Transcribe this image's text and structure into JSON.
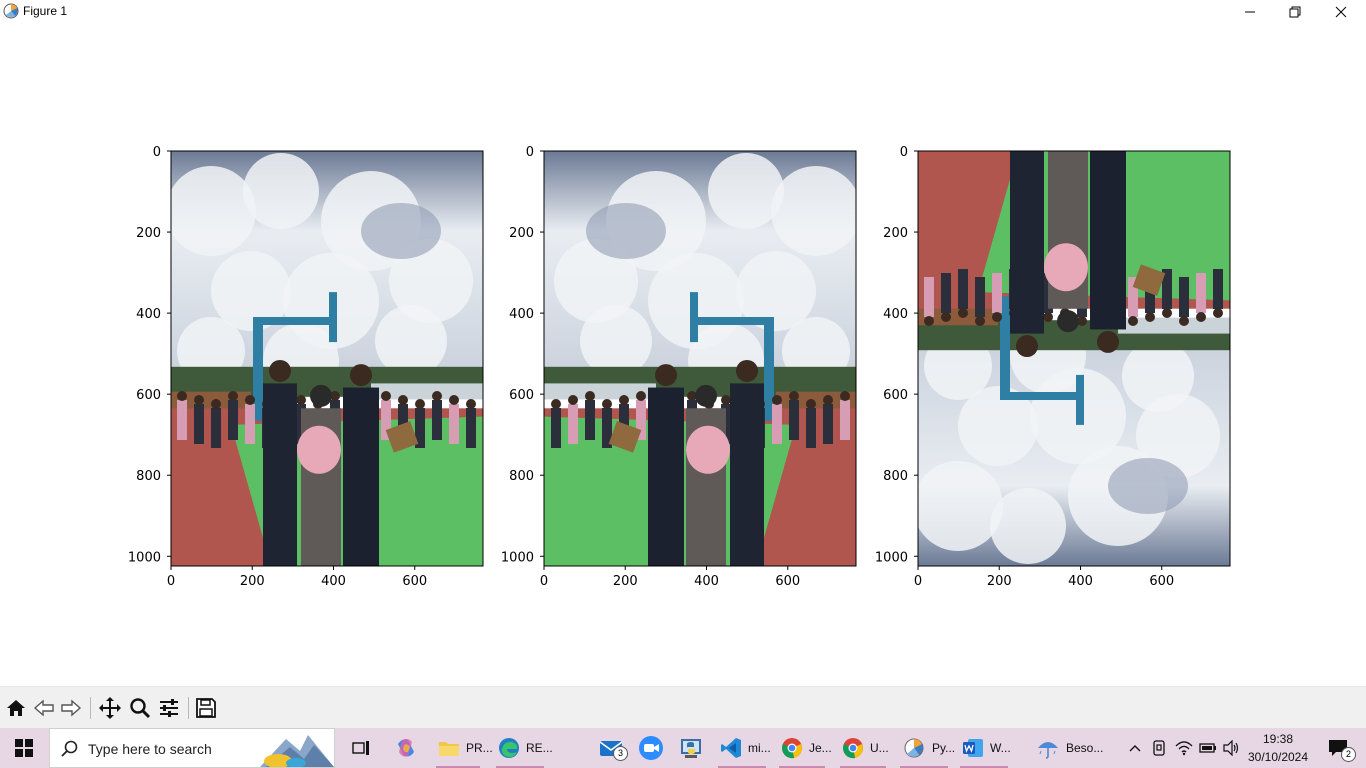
{
  "window": {
    "title": "Figure 1",
    "controls": [
      "minimize",
      "maximize",
      "close"
    ]
  },
  "figure": {
    "subplots": [
      {
        "image_desc_orientation": "original",
        "xticks": [
          "0",
          "200",
          "400",
          "600"
        ],
        "yticks": [
          "0",
          "200",
          "400",
          "600",
          "800",
          "1000"
        ]
      },
      {
        "image_desc_orientation": "horizontal-flip",
        "xticks": [
          "0",
          "200",
          "400",
          "600"
        ],
        "yticks": [
          "0",
          "200",
          "400",
          "600",
          "800",
          "1000"
        ]
      },
      {
        "image_desc_orientation": "vertical-flip",
        "xticks": [
          "0",
          "200",
          "400",
          "600"
        ],
        "yticks": [
          "0",
          "200",
          "400",
          "600",
          "800",
          "1000"
        ]
      }
    ]
  },
  "chart_data": [
    {
      "type": "table",
      "xlim": [
        0,
        768
      ],
      "ylim": [
        1024,
        0
      ],
      "xticks": [
        0,
        200,
        400,
        600
      ],
      "yticks": [
        0,
        200,
        400,
        600,
        800,
        1000
      ]
    },
    {
      "type": "table",
      "xlim": [
        0,
        768
      ],
      "ylim": [
        1024,
        0
      ],
      "xticks": [
        0,
        200,
        400,
        600
      ],
      "yticks": [
        0,
        200,
        400,
        600,
        800,
        1000
      ]
    },
    {
      "type": "table",
      "xlim": [
        0,
        768
      ],
      "ylim": [
        1024,
        0
      ],
      "xticks": [
        0,
        200,
        400,
        600
      ],
      "yticks": [
        0,
        200,
        400,
        600,
        800,
        1000
      ]
    }
  ],
  "toolbar": {
    "icons": [
      "home-icon",
      "back-icon",
      "forward-icon",
      "pan-icon",
      "zoom-icon",
      "configure-subplots-icon",
      "save-icon"
    ]
  },
  "taskbar": {
    "search_placeholder": "Type here to search",
    "apps": [
      {
        "icon": "file-explorer-icon",
        "label": "PR..."
      },
      {
        "icon": "edge-icon",
        "label": "RE..."
      },
      {
        "icon": "vscode-icon",
        "label": "mi..."
      },
      {
        "icon": "chrome-icon",
        "label": "Je..."
      },
      {
        "icon": "chrome-icon",
        "label": "U..."
      },
      {
        "icon": "python-figure-icon",
        "label": "Py..."
      },
      {
        "icon": "word-icon",
        "label": "W..."
      },
      {
        "icon": "weather-icon",
        "label": "Beso..."
      }
    ],
    "mail_badge": "3",
    "notification_badge": "2",
    "time": "19:38",
    "date": "30/10/2024"
  },
  "colors": {
    "taskbar_bg": "#e7d6e3",
    "toolbar_bg": "#f0f0f0",
    "sky_light": "#e9edf2",
    "sky_dark": "#6b7a95",
    "court_green": "#5dbf63",
    "court_red": "#b0564f",
    "hoop_blue": "#2e7fa3"
  }
}
